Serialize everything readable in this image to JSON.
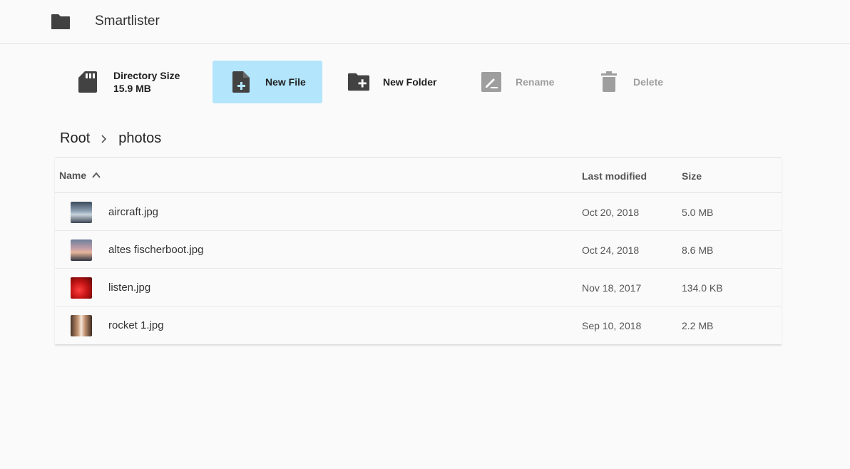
{
  "app": {
    "title": "Smartlister",
    "logo_icon": "folder-icon"
  },
  "toolbar": {
    "directory_size_label": "Directory Size",
    "directory_size_value": "15.9 MB",
    "new_file_label": "New File",
    "new_folder_label": "New Folder",
    "rename_label": "Rename",
    "delete_label": "Delete"
  },
  "breadcrumb": {
    "items": [
      "Root",
      "photos"
    ]
  },
  "table": {
    "columns": {
      "name": "Name",
      "modified": "Last modified",
      "size": "Size"
    },
    "rows": [
      {
        "name": "aircraft.jpg",
        "modified": "Oct 20, 2018",
        "size": "5.0 MB"
      },
      {
        "name": "altes fischerboot.jpg",
        "modified": "Oct 24, 2018",
        "size": "8.6 MB"
      },
      {
        "name": "listen.jpg",
        "modified": "Nov 18, 2017",
        "size": "134.0 KB"
      },
      {
        "name": "rocket 1.jpg",
        "modified": "Sep 10, 2018",
        "size": "2.2 MB"
      }
    ]
  },
  "colors": {
    "accent": "#b3e5fc",
    "icon": "#424242",
    "disabled": "#9e9e9e"
  }
}
